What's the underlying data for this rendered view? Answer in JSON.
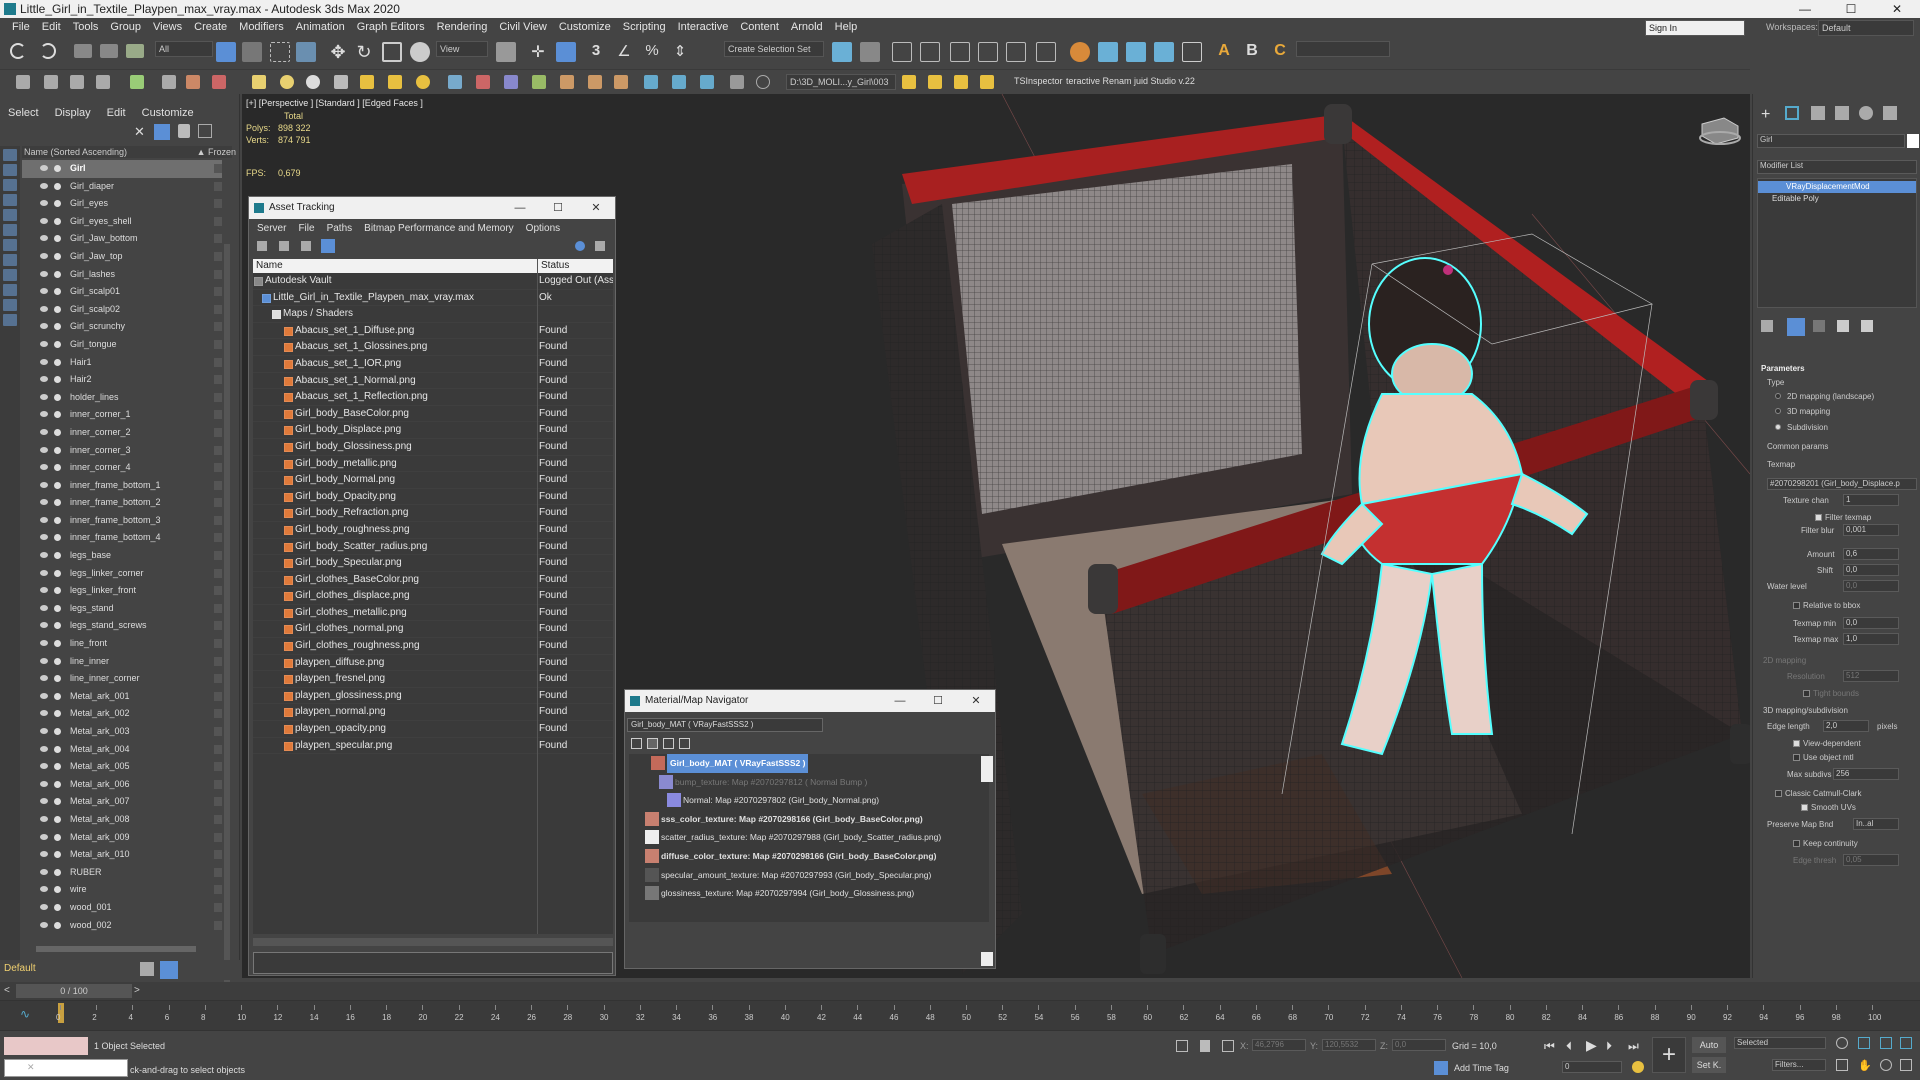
{
  "window": {
    "title": "Little_Girl_in_Textile_Playpen_max_vray.max - Autodesk 3ds Max 2020",
    "buttons": [
      "—",
      "☐",
      "✕"
    ]
  },
  "menu": [
    "File",
    "Edit",
    "Tools",
    "Group",
    "Views",
    "Create",
    "Modifiers",
    "Animation",
    "Graph Editors",
    "Rendering",
    "Civil View",
    "Customize",
    "Scripting",
    "Interactive",
    "Content",
    "Arnold",
    "Help"
  ],
  "account": {
    "sign_in": "Sign In",
    "workspaces_label": "Workspaces:",
    "workspace": "Default"
  },
  "toolbar": {
    "selection_filter": "All",
    "ref_coord": "View",
    "create_selection_set": "Create Selection Set",
    "project_path": "D:\\3D_MOLI...y_Girl\\003",
    "tsinspector": "TSInspector",
    "plugins": "teractive Renam juid Studio v.22"
  },
  "scene_explorer": {
    "tabs": [
      "Select",
      "Display",
      "Edit",
      "Customize"
    ],
    "column_name": "Name (Sorted Ascending)",
    "column_frozen": "▲ Frozen",
    "items": [
      "Girl",
      "Girl_diaper",
      "Girl_eyes",
      "Girl_eyes_shell",
      "Girl_Jaw_bottom",
      "Girl_Jaw_top",
      "Girl_lashes",
      "Girl_scalp01",
      "Girl_scalp02",
      "Girl_scrunchy",
      "Girl_tongue",
      "Hair1",
      "Hair2",
      "holder_lines",
      "inner_corner_1",
      "inner_corner_2",
      "inner_corner_3",
      "inner_corner_4",
      "inner_frame_bottom_1",
      "inner_frame_bottom_2",
      "inner_frame_bottom_3",
      "inner_frame_bottom_4",
      "legs_base",
      "legs_linker_corner",
      "legs_linker_front",
      "legs_stand",
      "legs_stand_screws",
      "line_front",
      "line_inner",
      "line_inner_corner",
      "Metal_ark_001",
      "Metal_ark_002",
      "Metal_ark_003",
      "Metal_ark_004",
      "Metal_ark_005",
      "Metal_ark_006",
      "Metal_ark_007",
      "Metal_ark_008",
      "Metal_ark_009",
      "Metal_ark_010",
      "RUBER",
      "wire",
      "wood_001",
      "wood_002"
    ],
    "selected_index": 0,
    "layer": "Default"
  },
  "viewport": {
    "label": "[+] [Perspective ] [Standard ] [Edged Faces ]",
    "total_label": "Total",
    "polys_label": "Polys:",
    "polys": "898 322",
    "verts_label": "Verts:",
    "verts": "874 791",
    "fps_label": "FPS:",
    "fps": "0,679"
  },
  "asset_tracking": {
    "title": "Asset Tracking",
    "menu": [
      "Server",
      "File",
      "Paths",
      "Bitmap Performance and Memory",
      "Options"
    ],
    "col_name": "Name",
    "col_status": "Status",
    "rows": [
      {
        "name": "Autodesk Vault",
        "status": "Logged Out (Ass",
        "level": 0
      },
      {
        "name": "Little_Girl_in_Textile_Playpen_max_vray.max",
        "status": "Ok",
        "level": 1
      },
      {
        "name": "Maps / Shaders",
        "status": "",
        "level": 2
      },
      {
        "name": "Abacus_set_1_Diffuse.png",
        "status": "Found",
        "level": 3
      },
      {
        "name": "Abacus_set_1_Glossines.png",
        "status": "Found",
        "level": 3
      },
      {
        "name": "Abacus_set_1_IOR.png",
        "status": "Found",
        "level": 3
      },
      {
        "name": "Abacus_set_1_Normal.png",
        "status": "Found",
        "level": 3
      },
      {
        "name": "Abacus_set_1_Reflection.png",
        "status": "Found",
        "level": 3
      },
      {
        "name": "Girl_body_BaseColor.png",
        "status": "Found",
        "level": 3
      },
      {
        "name": "Girl_body_Displace.png",
        "status": "Found",
        "level": 3
      },
      {
        "name": "Girl_body_Glossiness.png",
        "status": "Found",
        "level": 3
      },
      {
        "name": "Girl_body_metallic.png",
        "status": "Found",
        "level": 3
      },
      {
        "name": "Girl_body_Normal.png",
        "status": "Found",
        "level": 3
      },
      {
        "name": "Girl_body_Opacity.png",
        "status": "Found",
        "level": 3
      },
      {
        "name": "Girl_body_Refraction.png",
        "status": "Found",
        "level": 3
      },
      {
        "name": "Girl_body_roughness.png",
        "status": "Found",
        "level": 3
      },
      {
        "name": "Girl_body_Scatter_radius.png",
        "status": "Found",
        "level": 3
      },
      {
        "name": "Girl_body_Specular.png",
        "status": "Found",
        "level": 3
      },
      {
        "name": "Girl_clothes_BaseColor.png",
        "status": "Found",
        "level": 3
      },
      {
        "name": "Girl_clothes_displace.png",
        "status": "Found",
        "level": 3
      },
      {
        "name": "Girl_clothes_metallic.png",
        "status": "Found",
        "level": 3
      },
      {
        "name": "Girl_clothes_normal.png",
        "status": "Found",
        "level": 3
      },
      {
        "name": "Girl_clothes_roughness.png",
        "status": "Found",
        "level": 3
      },
      {
        "name": "playpen_diffuse.png",
        "status": "Found",
        "level": 3
      },
      {
        "name": "playpen_fresnel.png",
        "status": "Found",
        "level": 3
      },
      {
        "name": "playpen_glossiness.png",
        "status": "Found",
        "level": 3
      },
      {
        "name": "playpen_normal.png",
        "status": "Found",
        "level": 3
      },
      {
        "name": "playpen_opacity.png",
        "status": "Found",
        "level": 3
      },
      {
        "name": "playpen_specular.png",
        "status": "Found",
        "level": 3
      }
    ]
  },
  "material_navigator": {
    "title": "Material/Map Navigator",
    "current": "Girl_body_MAT  ( VRayFastSSS2 )",
    "rows": [
      {
        "text": "Girl_body_MAT  ( VRayFastSSS2 )",
        "style": "selected",
        "swatch": "#c46a5a"
      },
      {
        "text": "bump_texture: Map #2070297812  ( Normal Bump )",
        "style": "dim",
        "swatch": "#8a8ad0"
      },
      {
        "text": "Normal: Map #2070297802 (Girl_body_Normal.png)",
        "style": "normal",
        "swatch": "#8a8ae0"
      },
      {
        "text": "sss_color_texture: Map #2070298166 (Girl_body_BaseColor.png)",
        "style": "bold",
        "swatch": "#c88070"
      },
      {
        "text": "scatter_radius_texture: Map #2070297988 (Girl_body_Scatter_radius.png)",
        "style": "normal",
        "swatch": "#eeeeee"
      },
      {
        "text": "diffuse_color_texture: Map #2070298166 (Girl_body_BaseColor.png)",
        "style": "bold",
        "swatch": "#c88070"
      },
      {
        "text": "specular_amount_texture: Map #2070297993 (Girl_body_Specular.png)",
        "style": "normal",
        "swatch": "#555555"
      },
      {
        "text": "glossiness_texture: Map #2070297994 (Girl_body_Glossiness.png)",
        "style": "normal",
        "swatch": "#777777"
      }
    ]
  },
  "command_panel": {
    "object_name": "Girl",
    "modifier_list": "Modifier List",
    "stack": [
      "VRayDisplacementMod",
      "Editable Poly"
    ],
    "parameters": "Parameters",
    "type_label": "Type",
    "type_options": [
      "2D mapping (landscape)",
      "3D mapping",
      "Subdivision"
    ],
    "common_params": "Common params",
    "texmap_label": "Texmap",
    "texmap_value": "#2070298201 (Girl_body_Displace.p",
    "texture_chan_label": "Texture chan",
    "texture_chan": "1",
    "filter_texmap": "Filter texmap",
    "filter_blur_label": "Filter blur",
    "filter_blur": "0,001",
    "amount_label": "Amount",
    "amount": "0,6",
    "shift_label": "Shift",
    "shift": "0,0",
    "water_level_label": "Water level",
    "water_level": "0,0",
    "relative_bbox": "Relative to bbox",
    "texmap_min_label": "Texmap min",
    "texmap_min": "0,0",
    "texmap_max_label": "Texmap max",
    "texmap_max": "1,0",
    "mapping_2d": "2D mapping",
    "resolution_label": "Resolution",
    "resolution": "512",
    "tight_bounds": "Tight bounds",
    "mapping_3d": "3D mapping/subdivision",
    "edge_length_label": "Edge length",
    "edge_length": "2,0",
    "pixels": "pixels",
    "view_dependent": "View-dependent",
    "use_object_mtl": "Use object mtl",
    "max_subdivs_label": "Max subdivs",
    "max_subdivs": "256",
    "classic_catmull": "Classic Catmull-Clark",
    "smooth_uvs": "Smooth UVs",
    "preserve_map_bnd_label": "Preserve Map Bnd",
    "preserve_map_bnd": "In..al",
    "keep_continuity": "Keep continuity",
    "edge_thresh_label": "Edge thresh",
    "edge_thresh": "0,05"
  },
  "timeline": {
    "frame": "0 / 100",
    "ticks": [
      "0",
      "2",
      "4",
      "6",
      "8",
      "10",
      "12",
      "14",
      "16",
      "18",
      "20",
      "22",
      "24",
      "26",
      "28",
      "30",
      "32",
      "34",
      "36",
      "38",
      "40",
      "42",
      "44",
      "46",
      "48",
      "50",
      "52",
      "54",
      "56",
      "58",
      "60",
      "62",
      "64",
      "66",
      "68",
      "70",
      "72",
      "74",
      "76",
      "78",
      "80",
      "82",
      "84",
      "86",
      "88",
      "90",
      "92",
      "94",
      "96",
      "98",
      "100"
    ]
  },
  "status": {
    "selected": "1 Object Selected",
    "prompt": "ck-and-drag to select objects",
    "x_label": "X:",
    "x": "46,2796",
    "y_label": "Y:",
    "y": "120,5532",
    "z_label": "Z:",
    "z": "0,0",
    "grid": "Grid = 10,0",
    "add_time_tag": "Add Time Tag",
    "auto": "Auto",
    "set_k": "Set K.",
    "key_mode": "Selected",
    "filters": "Filters...",
    "time_field": "0"
  }
}
